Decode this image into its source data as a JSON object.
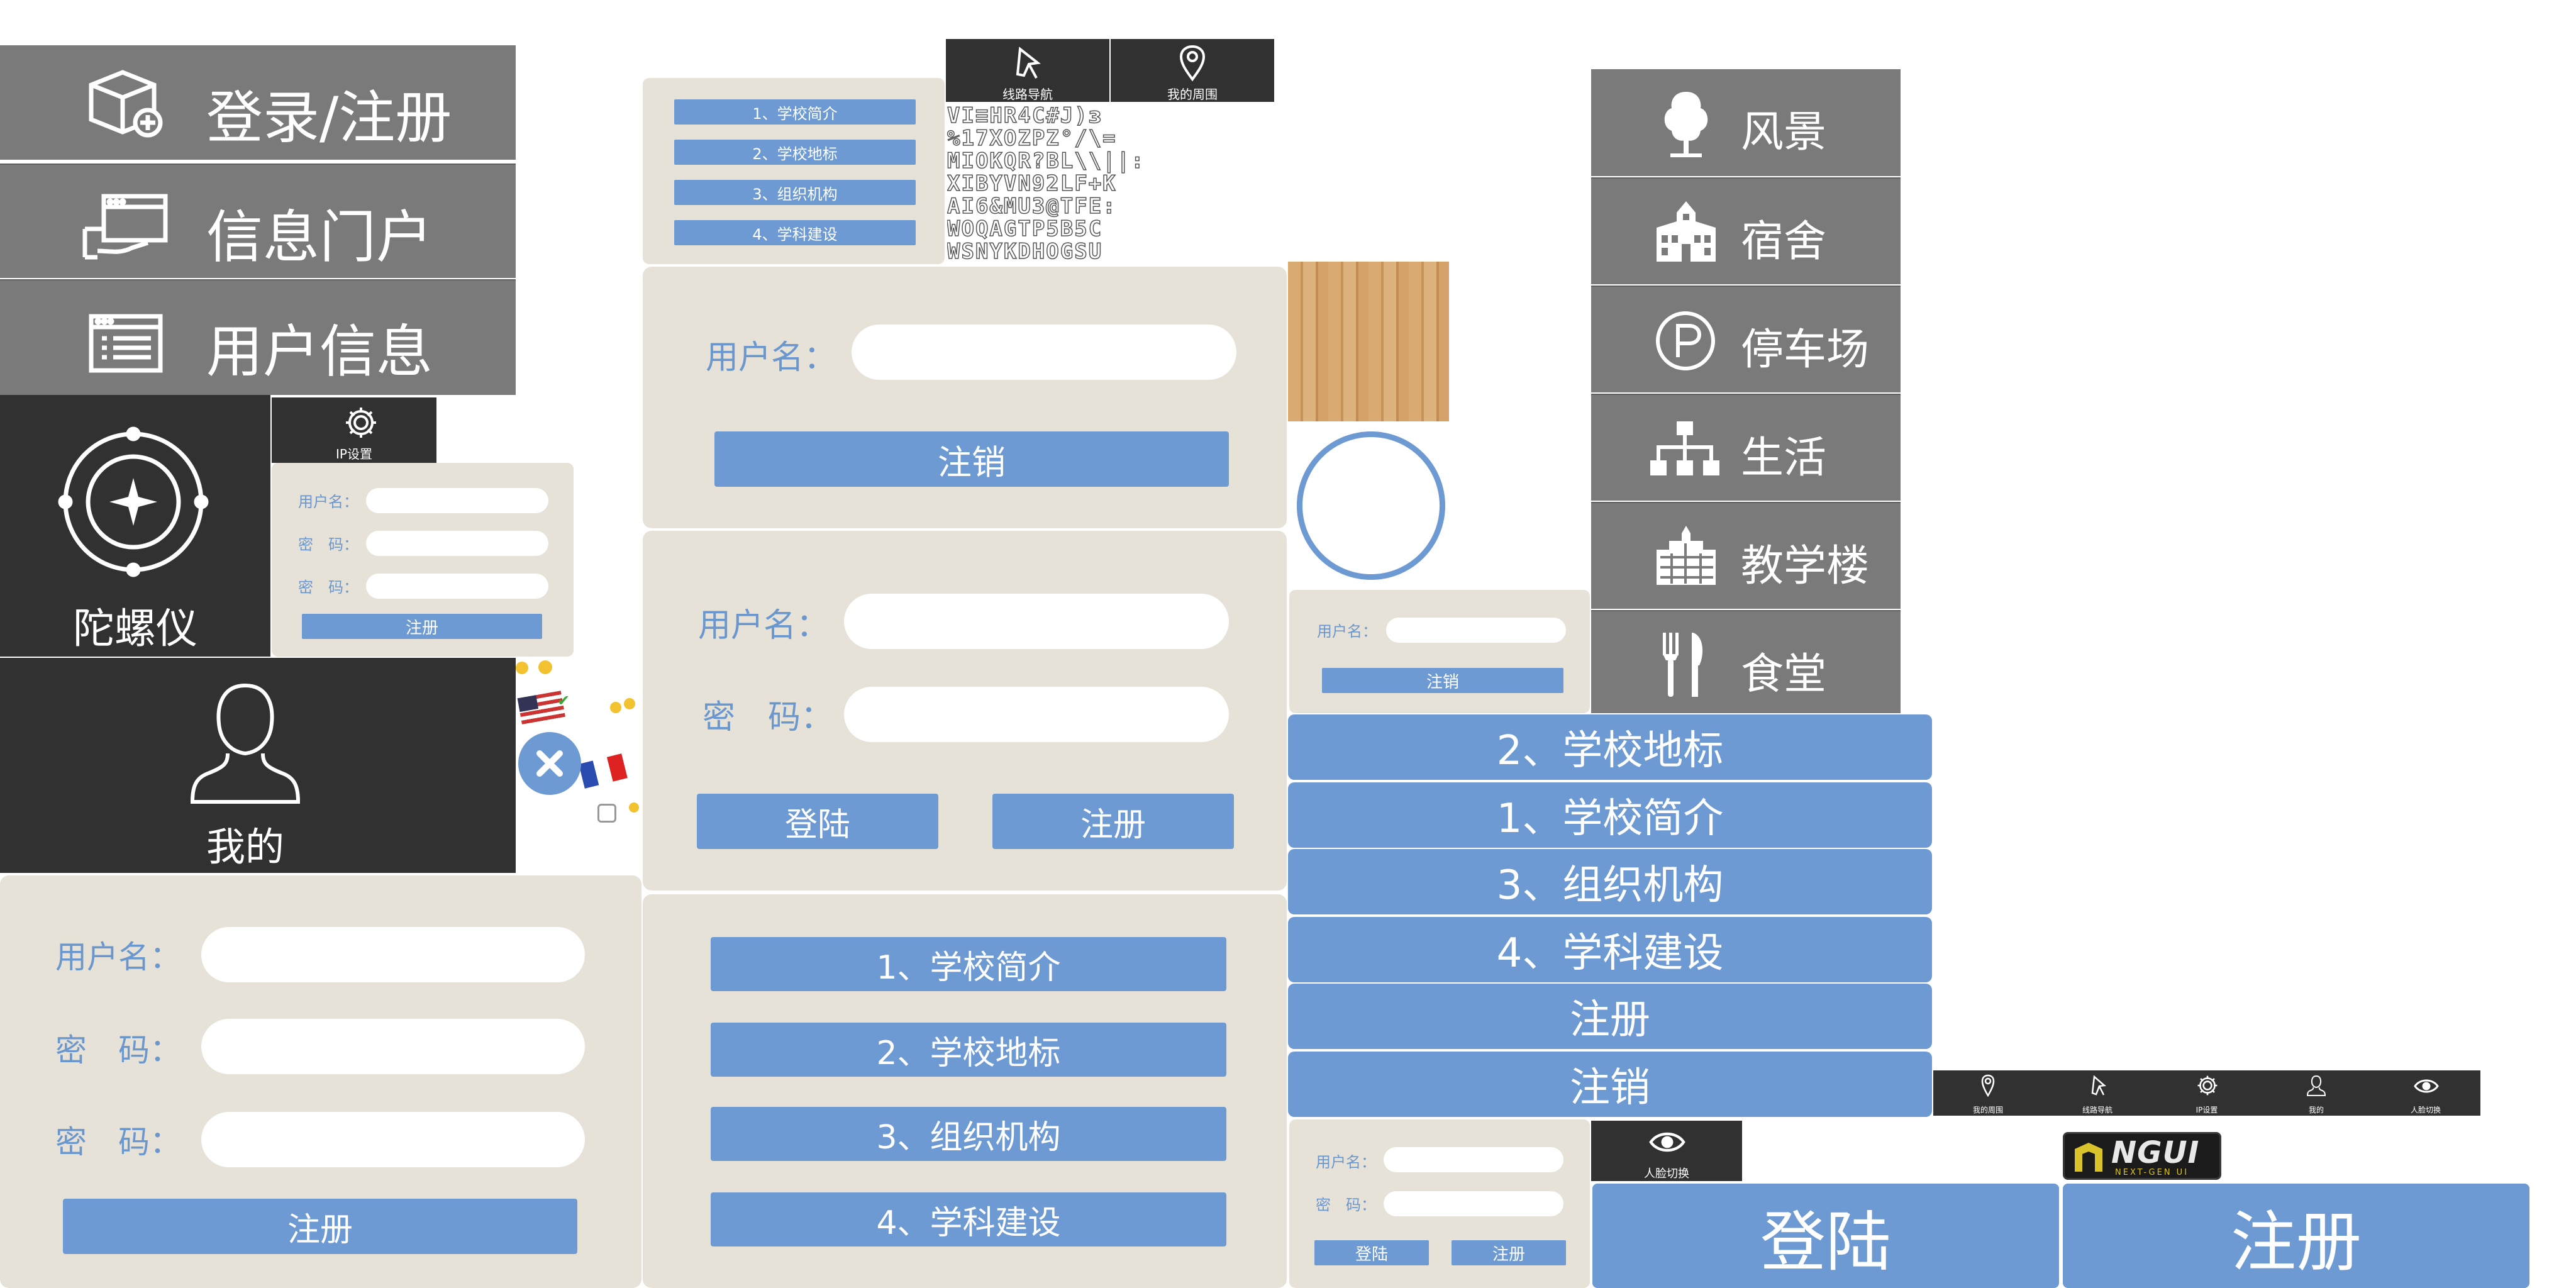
{
  "left_menu": {
    "login_register": "登录/注册",
    "info_portal": "信息门户",
    "user_info": "用户信息"
  },
  "gyroscope": {
    "label": "陀螺仪"
  },
  "ip_settings": {
    "label": "IP设置"
  },
  "mine": {
    "label": "我的"
  },
  "mini_register_form": {
    "username_label": "用户名：",
    "password_label": "密　码：",
    "confirm_label": "密　码：",
    "register_button": "注册"
  },
  "big_register_form": {
    "username_label": "用户名：",
    "password_label": "密　码：",
    "confirm_label": "密　码：",
    "register_button": "注册"
  },
  "small_school_menu": {
    "items": [
      "1、学校简介",
      "2、学校地标",
      "3、组织机构",
      "4、学科建设"
    ]
  },
  "top_nav": {
    "route_nav": "线路导航",
    "my_surroundings": "我的周围"
  },
  "logout_form": {
    "username_label": "用户名：",
    "logout_button": "注销"
  },
  "login_form": {
    "username_label": "用户名：",
    "password_label": "密　码：",
    "login_button": "登陆",
    "register_button": "注册"
  },
  "school_menu": {
    "items": [
      "1、学校简介",
      "2、学校地标",
      "3、组织机构",
      "4、学科建设"
    ]
  },
  "mini_logout_form": {
    "username_label": "用户名：",
    "logout_button": "注销"
  },
  "right_list": {
    "items": [
      "2、学校地标",
      "1、学校简介",
      "3、组织机构",
      "4、学科建设",
      "注册",
      "注销"
    ]
  },
  "mini_login_form": {
    "username_label": "用户名：",
    "password_label": "密　码：",
    "login_button": "登陆",
    "register_button": "注册"
  },
  "category_menu": {
    "scenery": "风景",
    "dormitory": "宿舍",
    "parking": "停车场",
    "life": "生活",
    "teaching_building": "教学楼",
    "canteen": "食堂"
  },
  "bottom_nav": {
    "my_surroundings": "我的周围",
    "route_nav": "线路导航",
    "ip_settings": "IP设置",
    "mine": "我的",
    "face_switch": "人脸切换"
  },
  "face_switch": {
    "label": "人脸切换"
  },
  "ngui_logo": {
    "main": "NGUI",
    "sub": "NEXT-GEN UI"
  },
  "big_buttons": {
    "login": "登陆",
    "register": "注册"
  },
  "font_atlas": {
    "rows": [
      "VI≡HR4C#J)ɜ",
      "%17XOZPZ°/\\=",
      "MIOKQR?BL\\\\||:",
      "XIBYVN92LF+K",
      "AI6&MU3@TFE:",
      "WOQAGTP5B5C",
      "WSNYKDHOGSU"
    ]
  },
  "colors": {
    "gray_tile": "#7a7a7a",
    "dark_tile": "#313131",
    "beige_panel": "#e6e2d8",
    "accent_blue": "#6e9ad3"
  }
}
